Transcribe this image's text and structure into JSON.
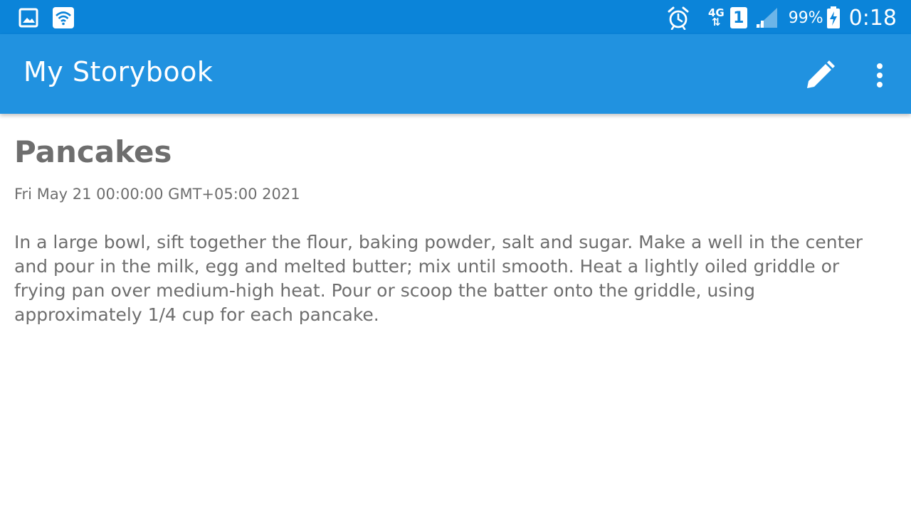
{
  "status_bar": {
    "left_icons": [
      "gallery-icon",
      "wifi-icon"
    ],
    "alarm_icon": "alarm-clock-icon",
    "network_type": "4G",
    "sim_slot": "1",
    "signal_icon": "signal-strength-icon",
    "battery_percent": "99%",
    "battery_icon": "battery-charging-icon",
    "time": "0:18"
  },
  "app_bar": {
    "title": "My Storybook",
    "actions": [
      "edit-pencil-icon",
      "more-vertical-icon"
    ]
  },
  "story": {
    "title": "Pancakes",
    "date": "Fri May 21 00:00:00 GMT+05:00 2021",
    "body": "In a large bowl, sift together the flour, baking powder, salt and sugar. Make a well in the center and pour in the milk, egg and melted butter; mix until smooth. Heat a lightly oiled griddle or frying pan over medium-high heat. Pour or scoop the batter onto the griddle, using approximately 1/4 cup for each pancake."
  },
  "colors": {
    "status_bar": "#0b84d9",
    "app_bar": "#2192e0",
    "text": "#6e6e6e",
    "background": "#ffffff"
  }
}
